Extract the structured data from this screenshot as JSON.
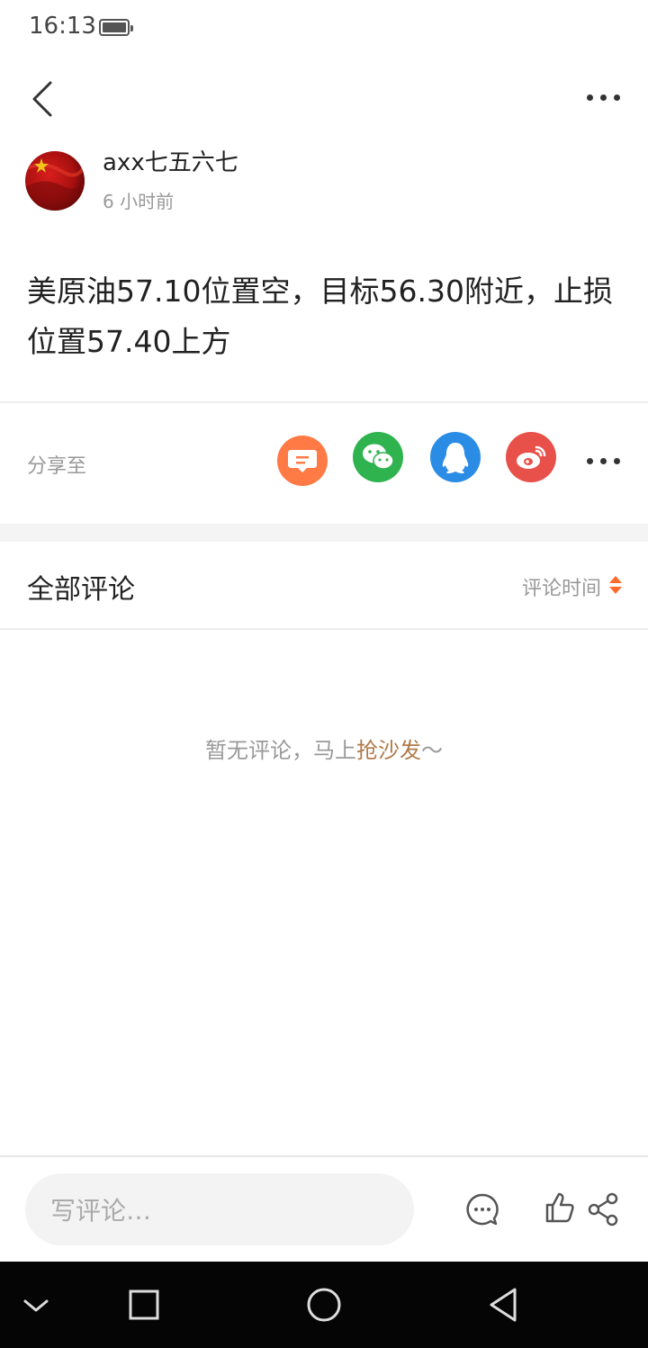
{
  "status_bar": {
    "time": "16:13"
  },
  "header": {
    "back_icon": "chevron-left-icon",
    "more_icon": "more-dots-icon"
  },
  "author": {
    "name": "axx七五六七",
    "time": "6 小时前",
    "avatar": "flag-avatar"
  },
  "post": {
    "text": "美原油57.10位置空，目标56.30附近，止损位置57.40上方"
  },
  "share": {
    "label": "分享至",
    "targets": [
      {
        "name": "message",
        "color": "#ff7a45"
      },
      {
        "name": "wechat",
        "color": "#2fb34e"
      },
      {
        "name": "qq",
        "color": "#2b8ce6"
      },
      {
        "name": "weibo",
        "color": "#e8514a"
      }
    ]
  },
  "comments": {
    "title": "全部评论",
    "sort_label": "评论时间",
    "empty_prefix": "暂无评论，马上",
    "empty_highlight": "抢沙发",
    "empty_suffix": "～"
  },
  "bottom_bar": {
    "input_placeholder": "写评论…"
  },
  "colors": {
    "accent": "#ff6a2b",
    "highlight": "#b07a4a"
  }
}
